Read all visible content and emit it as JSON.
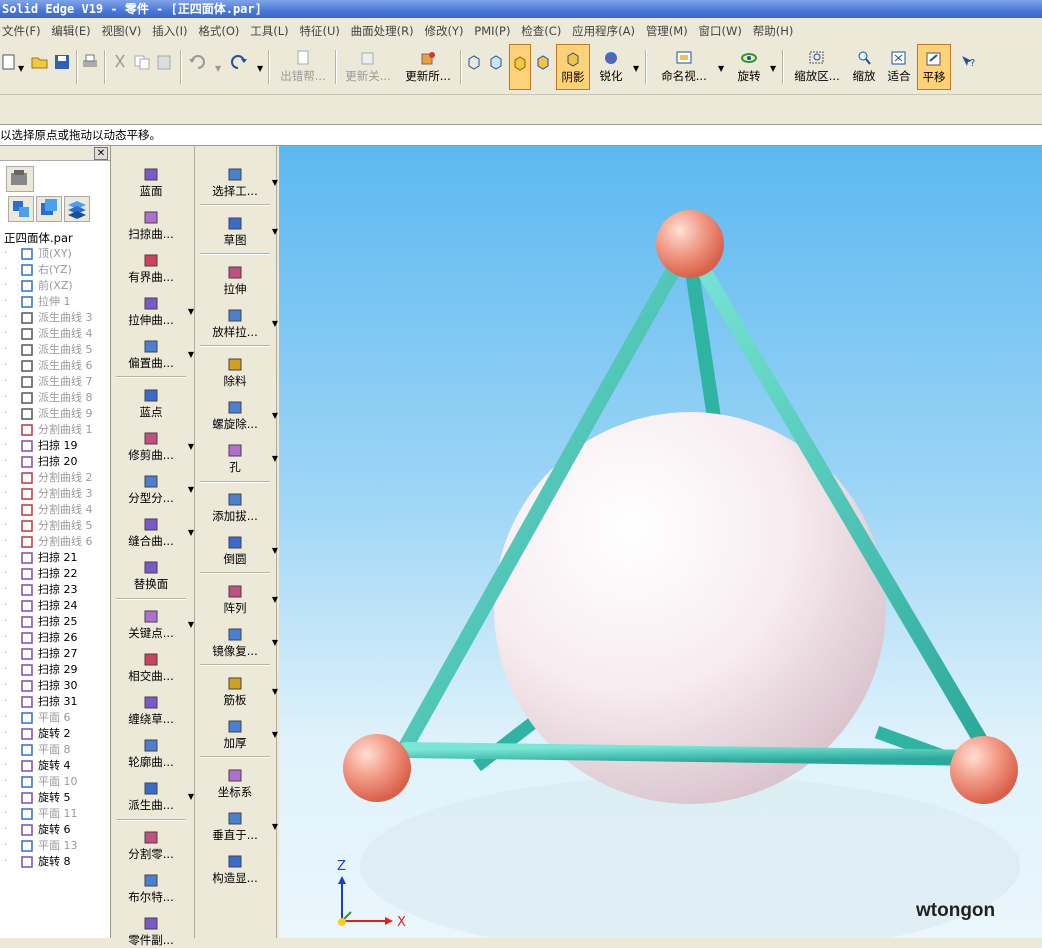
{
  "window": {
    "title": "Solid Edge V19 - 零件 - [正四面体.par]"
  },
  "menu": [
    "文件(F)",
    "编辑(E)",
    "视图(V)",
    "插入(I)",
    "格式(O)",
    "工具(L)",
    "特征(U)",
    "曲面处理(R)",
    "修改(Y)",
    "PMI(P)",
    "检查(C)",
    "应用程序(A)",
    "管理(M)",
    "窗口(W)",
    "帮助(H)"
  ],
  "toolbar": {
    "error_help": "出错帮...",
    "update_rel": "更新关...",
    "update_all": "更新所...",
    "shading": "阴影",
    "sharpen": "锐化",
    "named_view": "命名视...",
    "rotate": "旋转",
    "zoom_area": "缩放区...",
    "zoom": "缩放",
    "fit": "适合",
    "pan": "平移"
  },
  "prompt": "以选择原点或拖动以动态平移。",
  "tree": {
    "root": "正四面体.par",
    "items": [
      {
        "label": "顶(XY)",
        "state": "grey",
        "icon": "plane-icon"
      },
      {
        "label": "右(YZ)",
        "state": "grey",
        "icon": "plane-icon"
      },
      {
        "label": "前(XZ)",
        "state": "grey",
        "icon": "plane-icon"
      },
      {
        "label": "拉伸 1",
        "state": "grey",
        "icon": "extrude-icon"
      },
      {
        "label": "派生曲线 3",
        "state": "grey",
        "icon": "derived-curve-icon"
      },
      {
        "label": "派生曲线 4",
        "state": "grey",
        "icon": "derived-curve-icon"
      },
      {
        "label": "派生曲线 5",
        "state": "grey",
        "icon": "derived-curve-icon"
      },
      {
        "label": "派生曲线 6",
        "state": "grey",
        "icon": "derived-curve-icon"
      },
      {
        "label": "派生曲线 7",
        "state": "grey",
        "icon": "derived-curve-icon"
      },
      {
        "label": "派生曲线 8",
        "state": "grey",
        "icon": "derived-curve-icon"
      },
      {
        "label": "派生曲线 9",
        "state": "grey",
        "icon": "derived-curve-icon"
      },
      {
        "label": "分割曲线 1",
        "state": "grey",
        "icon": "split-curve-icon"
      },
      {
        "label": "扫掠 19",
        "state": "normal",
        "icon": "sweep-icon"
      },
      {
        "label": "扫掠 20",
        "state": "normal",
        "icon": "sweep-icon"
      },
      {
        "label": "分割曲线 2",
        "state": "grey",
        "icon": "split-curve-icon"
      },
      {
        "label": "分割曲线 3",
        "state": "grey",
        "icon": "split-curve-icon"
      },
      {
        "label": "分割曲线 4",
        "state": "grey",
        "icon": "split-curve-icon"
      },
      {
        "label": "分割曲线 5",
        "state": "grey",
        "icon": "split-curve-icon"
      },
      {
        "label": "分割曲线 6",
        "state": "grey",
        "icon": "split-curve-icon"
      },
      {
        "label": "扫掠 21",
        "state": "normal",
        "icon": "sweep-icon"
      },
      {
        "label": "扫掠 22",
        "state": "normal",
        "icon": "sweep-icon"
      },
      {
        "label": "扫掠 23",
        "state": "normal",
        "icon": "sweep-icon"
      },
      {
        "label": "扫掠 24",
        "state": "normal",
        "icon": "sweep-icon"
      },
      {
        "label": "扫掠 25",
        "state": "normal",
        "icon": "sweep-icon"
      },
      {
        "label": "扫掠 26",
        "state": "normal",
        "icon": "sweep-icon"
      },
      {
        "label": "扫掠 27",
        "state": "normal",
        "icon": "sweep-icon"
      },
      {
        "label": "扫掠 29",
        "state": "normal",
        "icon": "sweep-icon"
      },
      {
        "label": "扫掠 30",
        "state": "normal",
        "icon": "sweep-icon"
      },
      {
        "label": "扫掠 31",
        "state": "normal",
        "icon": "sweep-icon"
      },
      {
        "label": "平面 6",
        "state": "grey",
        "icon": "plane-icon"
      },
      {
        "label": "旋转 2",
        "state": "normal",
        "icon": "revolve-icon"
      },
      {
        "label": "平面 8",
        "state": "grey",
        "icon": "plane-icon"
      },
      {
        "label": "旋转 4",
        "state": "normal",
        "icon": "revolve-icon"
      },
      {
        "label": "平面 10",
        "state": "grey",
        "icon": "plane-icon"
      },
      {
        "label": "旋转 5",
        "state": "normal",
        "icon": "revolve-icon"
      },
      {
        "label": "平面 11",
        "state": "grey",
        "icon": "plane-icon"
      },
      {
        "label": "旋转 6",
        "state": "normal",
        "icon": "revolve-icon"
      },
      {
        "label": "平面 13",
        "state": "grey",
        "icon": "plane-icon"
      },
      {
        "label": "旋转 8",
        "state": "normal",
        "icon": "revolve-icon"
      }
    ]
  },
  "surface_commands": [
    "蓝面",
    "扫掠曲...",
    "有界曲...",
    "拉伸曲...",
    "偏置曲...",
    "蓝点",
    "修剪曲...",
    "分型分...",
    "缝合曲...",
    "替换面",
    "关键点...",
    "相交曲...",
    "缠绕草...",
    "轮廓曲...",
    "派生曲...",
    "分割零...",
    "布尔特...",
    "零件副..."
  ],
  "feature_commands": [
    "选择工...",
    "草图",
    "拉伸",
    "放样拉...",
    "除料",
    "螺旋除...",
    "孔",
    "添加拔...",
    "倒圆",
    "阵列",
    "镜像复...",
    "筋板",
    "加厚",
    "坐标系",
    "垂直于...",
    "构造显..."
  ],
  "viewport": {
    "triad": {
      "z": "Z",
      "x": "X"
    },
    "watermark": "wtongon",
    "colors": {
      "tube": "#3cc7b7",
      "sphere": "#f2e6ec",
      "vertex": "#f08070",
      "bg_top": "#5cb8f0"
    }
  }
}
